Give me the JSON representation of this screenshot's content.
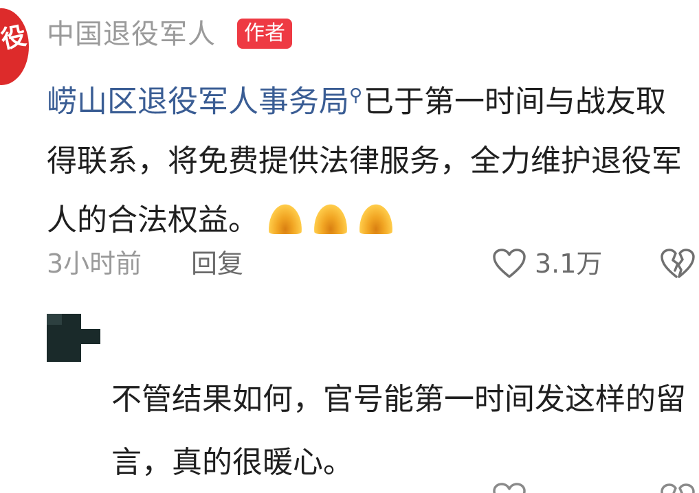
{
  "comment": {
    "author": "中国退役军人",
    "avatar_text": "役",
    "author_badge": "作者",
    "mention": "崂山区退役军人事务局",
    "mention_icon": "search-icon",
    "body_text": "已于第一时间与战友取得联系，将免费提供法律服务，全力维护退役军人的合法权益。",
    "emoji": "pray-emoji",
    "emoji_count": 3,
    "time": "3小时前",
    "reply_label": "回复",
    "like_count": "3.1万",
    "accent_color": "#ee3a43",
    "mention_color": "#3a5d94"
  },
  "reply": {
    "text": "不管结果如何，官号能第一时间发这样的留言，真的很暖心。"
  },
  "next_row": {
    "text": ""
  }
}
